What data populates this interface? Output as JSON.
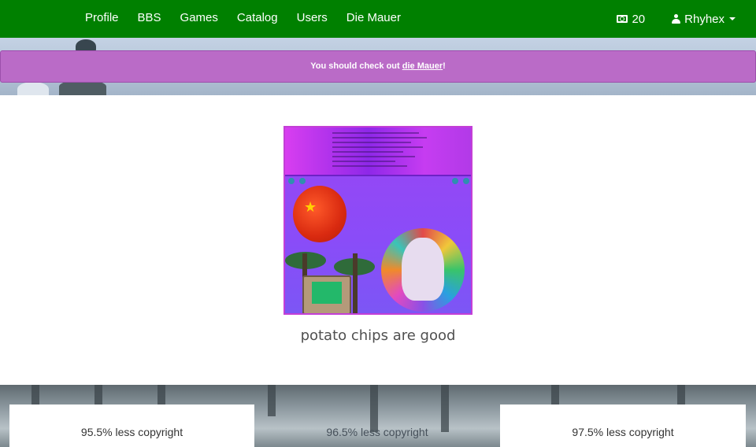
{
  "navbar": {
    "links": [
      "Profile",
      "BBS",
      "Games",
      "Catalog",
      "Users",
      "Die Mauer"
    ],
    "balance": "20",
    "balance_icon": "money-icon",
    "username": "Rhyhex",
    "user_icon": "user-icon",
    "bg_color": "#008000"
  },
  "banner": {
    "text_before": "You should check out ",
    "link_text": "die Mauer",
    "text_after": "!",
    "bg_color": "#ba6bc7"
  },
  "featured": {
    "caption": "potato chips are good"
  },
  "cards": [
    "95.5% less copyright",
    "96.5% less copyright",
    "97.5% less copyright"
  ]
}
